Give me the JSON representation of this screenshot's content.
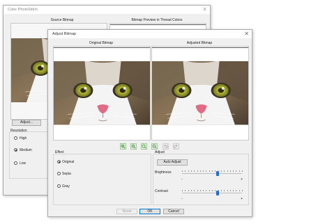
{
  "back_window": {
    "title": "Color PhotoStitch",
    "source_label": "Source Bitmap",
    "preview_label": "Bitmap Preview in Thread Colors",
    "adjust_button": "Adjust...",
    "resolution_label": "Resolution",
    "resolution_options": [
      "High",
      "Medium",
      "Low"
    ],
    "resolution_selected": "Medium"
  },
  "dialog": {
    "title": "Adjust Bitmap",
    "original_label": "Original Bitmap",
    "adjusted_label": "Adjusted Bitmap",
    "toolbar_icons": [
      "zoom-in-icon",
      "zoom-out-icon",
      "zoom-actual-icon",
      "zoom-fit-icon",
      "undo-icon",
      "redo-icon"
    ],
    "effect": {
      "label": "Effect",
      "options": [
        "Original",
        "Sepia",
        "Gray"
      ],
      "selected": "Original"
    },
    "adjust": {
      "label": "Adjust",
      "auto_button": "Auto Adjust",
      "brightness_label": "Brightness",
      "contrast_label": "Contrast",
      "brightness_value": 0.59,
      "contrast_value": 0.59,
      "min_symbol": "-",
      "max_symbol": "+"
    },
    "buttons": {
      "reset": "Reset",
      "ok": "OK",
      "cancel": "Cancel"
    }
  }
}
